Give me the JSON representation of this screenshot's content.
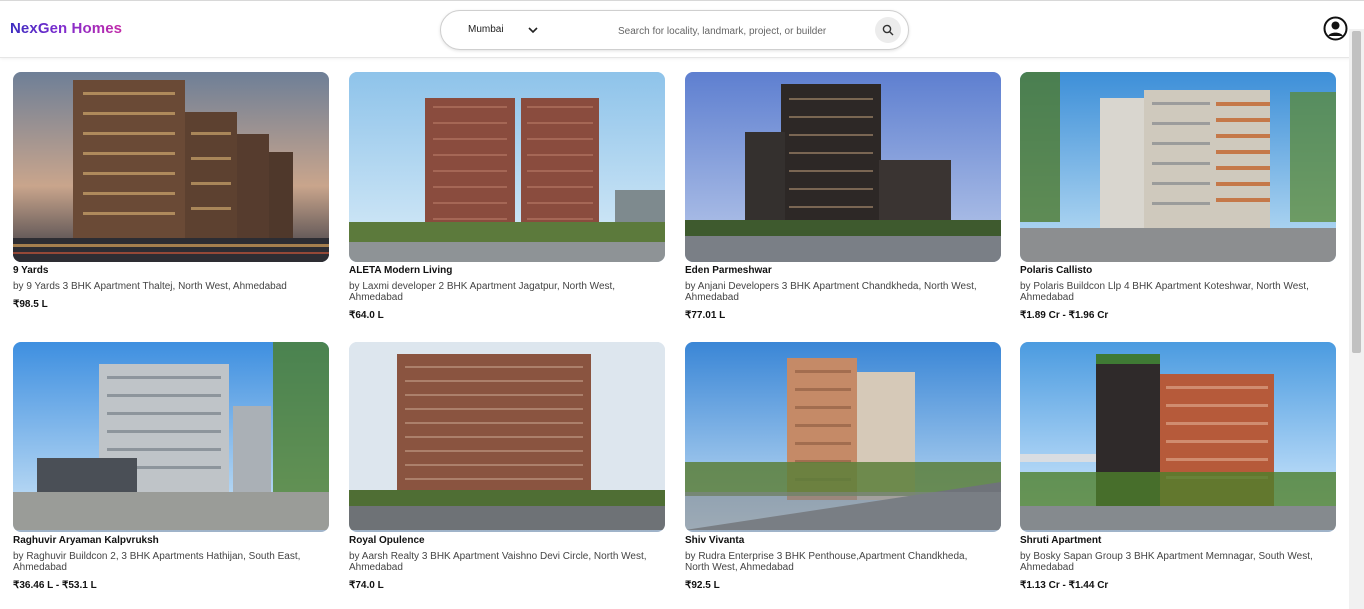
{
  "header": {
    "logo": "NexGen Homes",
    "city": "Mumbai",
    "search_placeholder": "Search for locality, landmark, project, or builder"
  },
  "listings": [
    {
      "name": "9 Yards",
      "description": "by 9 Yards 3 BHK Apartment Thaltej, North West, Ahmedabad",
      "price": "₹98.5 L"
    },
    {
      "name": "ALETA Modern Living",
      "description": "by Laxmi developer 2 BHK Apartment Jagatpur, North West, Ahmedabad",
      "price": "₹64.0 L"
    },
    {
      "name": "Eden Parmeshwar",
      "description": "by Anjani Developers 3 BHK Apartment Chandkheda, North West, Ahmedabad",
      "price": "₹77.01 L"
    },
    {
      "name": "Polaris Callisto",
      "description": "by Polaris Buildcon Llp 4 BHK Apartment Koteshwar, North West, Ahmedabad",
      "price": "₹1.89 Cr - ₹1.96 Cr"
    },
    {
      "name": "Raghuvir Aryaman Kalpvruksh",
      "description": "by Raghuvir Buildcon 2, 3 BHK Apartments Hathijan, South East, Ahmedabad",
      "price": "₹36.46 L - ₹53.1 L"
    },
    {
      "name": "Royal Opulence",
      "description": "by Aarsh Realty 3 BHK Apartment Vaishno Devi Circle, North West, Ahmedabad",
      "price": "₹74.0 L"
    },
    {
      "name": "Shiv Vivanta",
      "description": "by Rudra Enterprise 3 BHK Penthouse,Apartment Chandkheda, North West, Ahmedabad",
      "price": "₹92.5 L"
    },
    {
      "name": "Shruti Apartment",
      "description": "by Bosky Sapan Group 3 BHK Apartment Memnagar, South West, Ahmedabad",
      "price": "₹1.13 Cr - ₹1.44 Cr"
    }
  ]
}
